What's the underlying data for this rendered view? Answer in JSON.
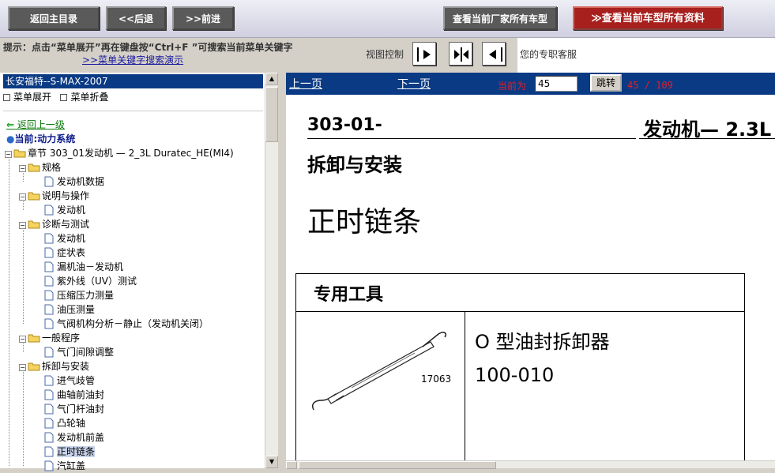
{
  "toolbar": {
    "home_label": "返回主目录",
    "back_label": "<<后退",
    "forward_label": ">>前进",
    "manufacturer_models_label": "查看当前厂家所有车型",
    "model_docs_label": "查看当前车型所有资料"
  },
  "hint": {
    "text": "提示：点击“菜单展开”再在键盘按“Ctrl+F ”可搜索当前菜单关键字",
    "demo_link": ">>菜单关键字搜索演示",
    "view_control_label": "视图控制",
    "customer_service": "您的专职客服"
  },
  "sidebar": {
    "model_title": "长安福特--S-MAX-2007",
    "expand_label": "菜单展开",
    "collapse_label": "菜单折叠",
    "back_link": "返回上一级",
    "current_label": "当前:动力系统",
    "chapter": "章节 303_01发动机 — 2_3L Duratec_HE(MI4)",
    "groups": [
      {
        "label": "规格",
        "items": [
          "发动机数据"
        ]
      },
      {
        "label": "说明与操作",
        "items": [
          "发动机"
        ]
      },
      {
        "label": "诊断与测试",
        "items": [
          "发动机",
          "症状表",
          "漏机油－发动机",
          "紫外线（UV）测试",
          "压缩压力测量",
          "油压测量",
          "气阀机构分析－静止（发动机关闭）"
        ]
      },
      {
        "label": "一般程序",
        "items": [
          "气门间隙调整"
        ]
      },
      {
        "label": "拆卸与安装",
        "items": [
          "进气歧管",
          "曲轴前油封",
          "气门杆油封",
          "凸轮轴",
          "发动机前盖",
          "正时链条",
          "汽缸盖"
        ]
      }
    ]
  },
  "navbar": {
    "prev_label": "上一页",
    "next_label": "下一页",
    "current_label": "当前为",
    "page_value": "45",
    "jump_label": "跳转",
    "page_count": "45 / 109"
  },
  "document": {
    "code": "303-01-",
    "engine": "发动机— 2.3L",
    "section": "拆卸与安装",
    "topic": "正时链条",
    "tools_header": "专用工具",
    "tool_name": "O 型油封拆卸器",
    "tool_number": "100-010",
    "image_caption": "17063"
  }
}
